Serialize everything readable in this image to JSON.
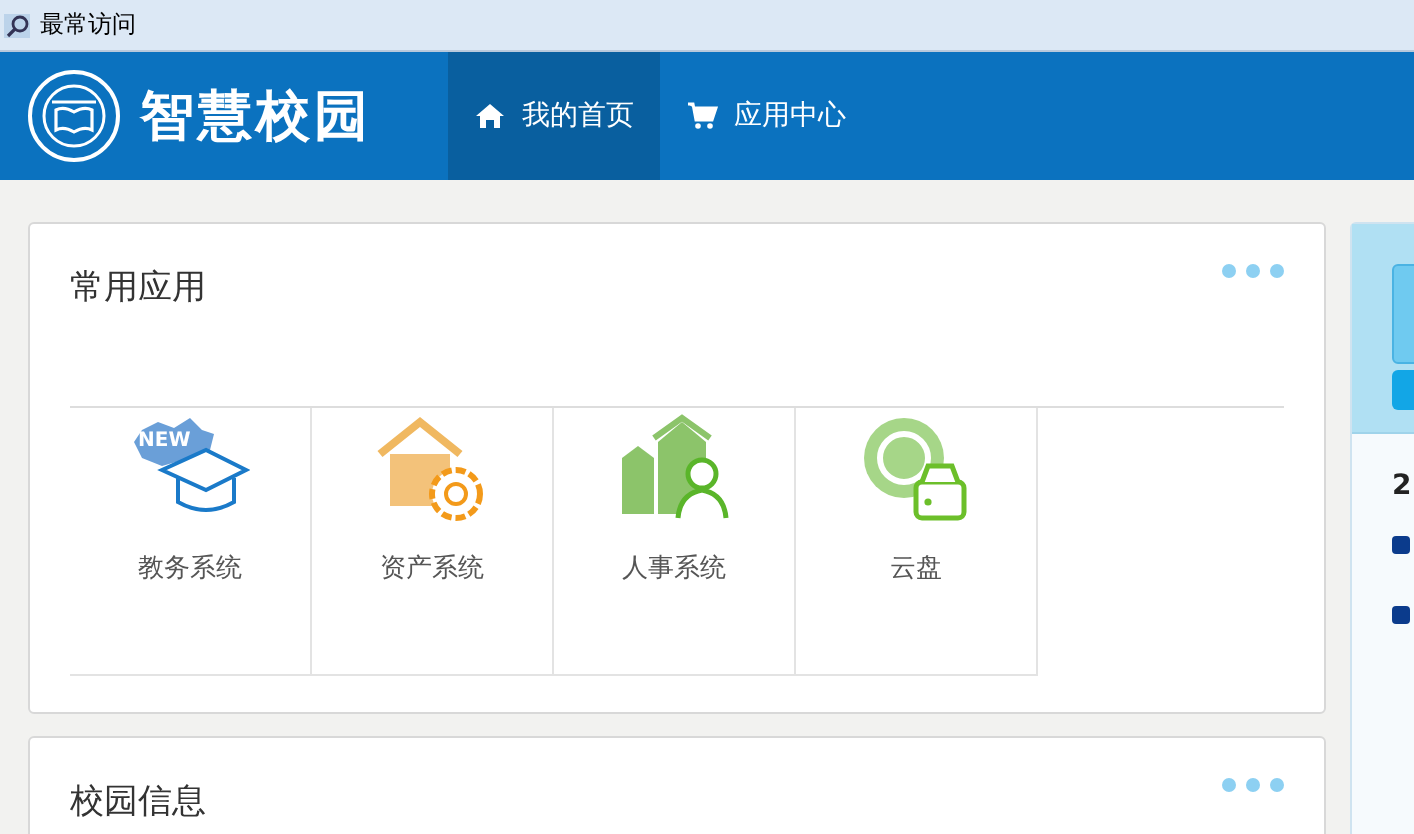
{
  "favorites_bar": {
    "label": "最常访问"
  },
  "header": {
    "logo_text": "智慧校园",
    "nav": [
      {
        "label": "我的首页",
        "kind": "home",
        "selected": true
      },
      {
        "label": "应用中心",
        "kind": "cart",
        "selected": false
      }
    ]
  },
  "cards": [
    {
      "title": "常用应用",
      "apps": [
        {
          "label": "教务系统",
          "kind": "edu",
          "badge": "NEW"
        },
        {
          "label": "资产系统",
          "kind": "asset"
        },
        {
          "label": "人事系统",
          "kind": "hr"
        },
        {
          "label": "云盘",
          "kind": "disk"
        }
      ]
    },
    {
      "title": "校园信息"
    }
  ],
  "side_panel": {
    "heading": "2"
  }
}
